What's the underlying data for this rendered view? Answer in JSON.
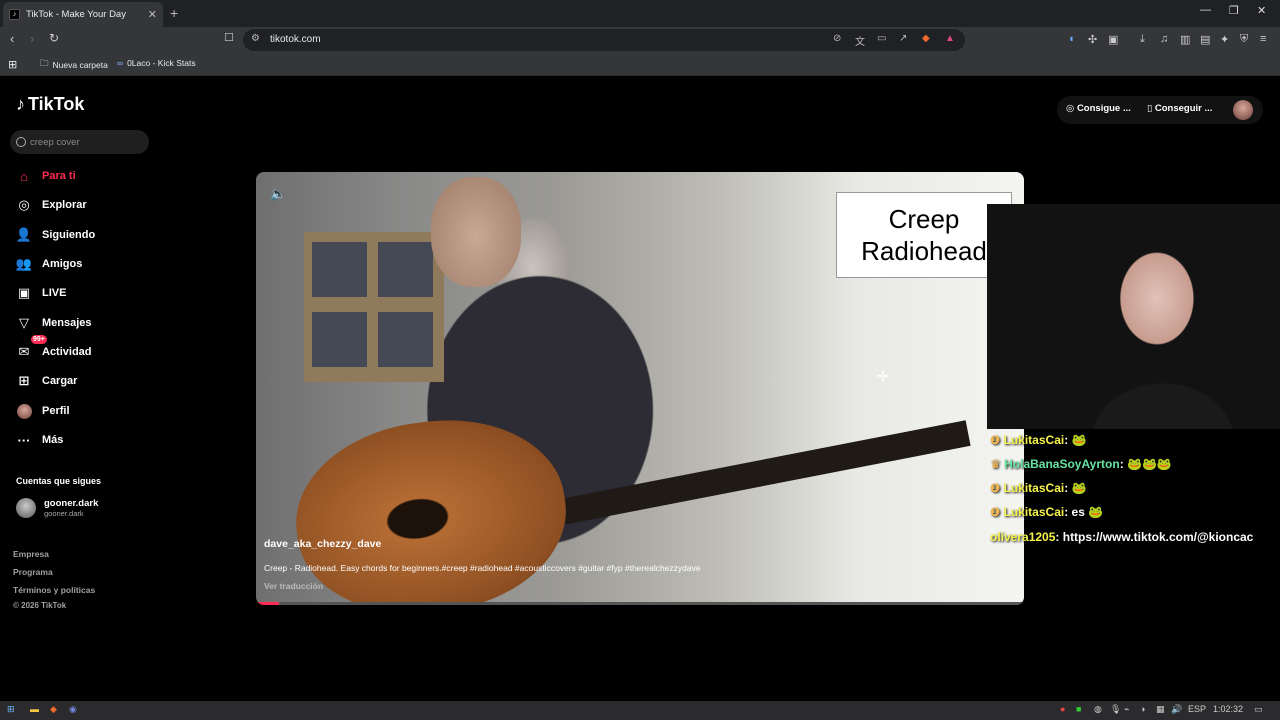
{
  "browser": {
    "tab_title": "TikTok - Make Your Day",
    "tab_close": "✕",
    "new_tab": "+",
    "url": "tikotok.com",
    "window_controls": [
      "—",
      "❐",
      "✕"
    ]
  },
  "bookmarks": [
    {
      "label": "Nueva carpeta",
      "icon": "folder-icon"
    },
    {
      "label": "0Laco - Kick Stats",
      "icon": "kick-stats-icon"
    }
  ],
  "sidebar": {
    "logo": "TikTok",
    "search_value": "creep cover",
    "nav": [
      {
        "label": "Para ti",
        "icon": "home-icon",
        "active": true
      },
      {
        "label": "Explorar",
        "icon": "compass-icon"
      },
      {
        "label": "Siguiendo",
        "icon": "following-icon"
      },
      {
        "label": "Amigos",
        "icon": "friends-icon"
      },
      {
        "label": "LIVE",
        "icon": "live-icon"
      },
      {
        "label": "Mensajes",
        "icon": "messages-icon"
      },
      {
        "label": "Actividad",
        "icon": "activity-icon",
        "badge": "99+"
      },
      {
        "label": "Cargar",
        "icon": "upload-icon"
      },
      {
        "label": "Perfil",
        "icon": "profile-icon"
      },
      {
        "label": "Más",
        "icon": "more-icon"
      }
    ],
    "following_title": "Cuentas que sigues",
    "following": [
      {
        "name": "gooner.dark",
        "handle": "gooner.dark"
      }
    ],
    "footer": [
      "Empresa",
      "Programa",
      "Términos y políticas",
      "© 2026 TikTok"
    ]
  },
  "topbar": {
    "coins_label": "Consigue ...",
    "app_label": "Conseguir ..."
  },
  "video": {
    "sign_line1": "Creep",
    "sign_line2": "Radiohead",
    "author": "dave_aka_chezzy_dave",
    "description": "Creep - Radiohead. Easy chords for beginners.#creep #radiohead #acousticcovers #guitar #fyp #therealchezzydave",
    "translate": "Ver traducción",
    "progress": 0.03
  },
  "stream_chat": [
    {
      "user": "LukitasCai",
      "message": "🐸"
    },
    {
      "user": "HolaBanaSoyAyrton",
      "message": "🐸🐸🐸"
    },
    {
      "user": "LukitasCai",
      "message": "🐸"
    },
    {
      "user": "LukitasCai",
      "message": "es 🐸"
    },
    {
      "user": "olivera1205",
      "message": "https://www.tiktok.com/@kioncac"
    }
  ],
  "taskbar": {
    "language": "ESP",
    "clock": "1:02:32"
  },
  "colors": {
    "accent": "#fe2c55",
    "chat_user": "#f6f44a"
  }
}
